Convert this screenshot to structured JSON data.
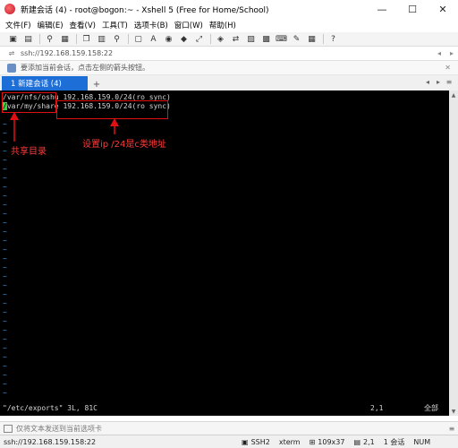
{
  "window": {
    "title": "新建会话 (4) - root@bogon:~ - Xshell 5 (Free for Home/School)",
    "controls": [
      "—",
      "☐",
      "✕"
    ]
  },
  "menu": {
    "items": [
      "文件(F)",
      "编辑(E)",
      "查看(V)",
      "工具(T)",
      "选项卡(B)",
      "窗口(W)",
      "帮助(H)"
    ]
  },
  "toolbar": {
    "icons": [
      "new-session-icon",
      "open-folder-icon",
      "link-icon",
      "properties-icon",
      "copy-icon",
      "paste-icon",
      "find-icon",
      "fullscreen-icon",
      "font-icon",
      "globe-icon",
      "color-icon",
      "expand-icon",
      "xftp-icon",
      "transfer-icon",
      "script-icon",
      "lock-icon",
      "keyboard-icon",
      "compose-icon",
      "layout-icon",
      "help-icon"
    ]
  },
  "address": {
    "text": "ssh://192.168.159.158:22"
  },
  "hint": {
    "text": "要添加当前会话，点击左侧的箭头按钮。"
  },
  "tabs": {
    "active_label": "1 新建会话 (4)",
    "add": "+"
  },
  "terminal": {
    "lines": [
      {
        "path": "/var/nfs/oshu",
        "rule": "192.168.159.0/24(ro sync)"
      },
      {
        "path": "/var/my/share",
        "rule": "192.168.159.0/24(ro sync)"
      }
    ],
    "cursor_char": "/",
    "tilde": "~",
    "status_left": "\"/etc/exports\" 3L, 81C",
    "status_pos": "2,1",
    "status_all": "全部"
  },
  "annotations": {
    "shared_dir": "共享目录",
    "ip_note": "设置ip /24是c类地址"
  },
  "inputbar": {
    "placeholder": "仅将文本发送到当前选项卡"
  },
  "statusbar": {
    "connection": "ssh://192.168.159.158:22",
    "protocol": "SSH2",
    "terminal": "xterm",
    "size": "109x37",
    "cursor": "2,1",
    "sessions": "1 会话",
    "num": "NUM"
  },
  "colors": {
    "tab_active": "#1e6ed8",
    "annotation": "#ff3b3b",
    "tilde": "#3b8ed6",
    "cursor": "#3fd13f"
  }
}
